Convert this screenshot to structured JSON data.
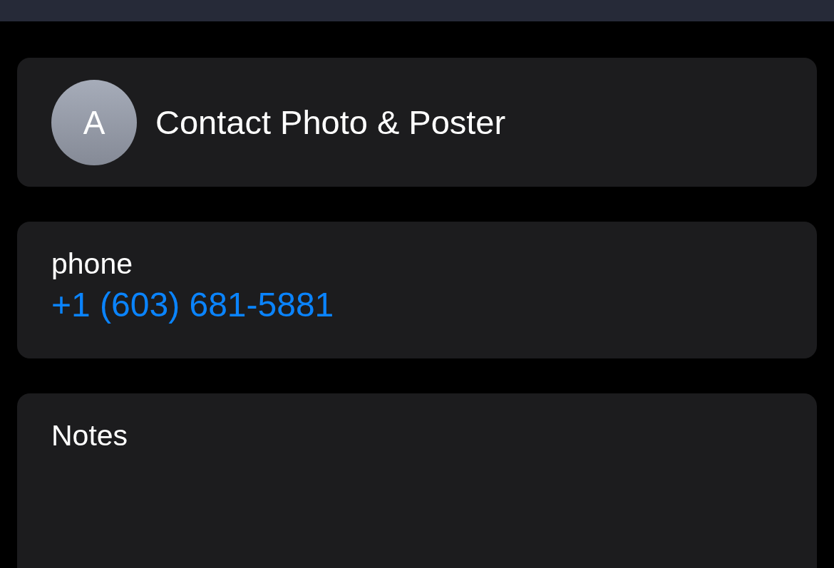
{
  "contact_header": {
    "avatar_initial": "A",
    "title": "Contact Photo & Poster"
  },
  "phone": {
    "label": "phone",
    "value": "+1 (603) 681-5881"
  },
  "notes": {
    "label": "Notes"
  }
}
